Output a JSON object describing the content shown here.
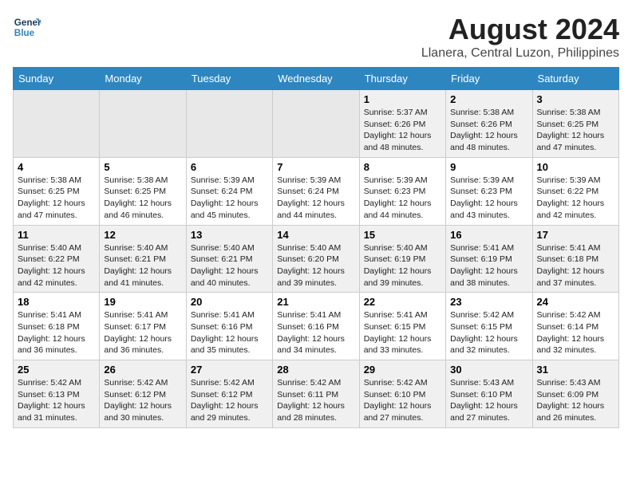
{
  "header": {
    "logo_line1": "General",
    "logo_line2": "Blue",
    "month_year": "August 2024",
    "location": "Llanera, Central Luzon, Philippines"
  },
  "days_of_week": [
    "Sunday",
    "Monday",
    "Tuesday",
    "Wednesday",
    "Thursday",
    "Friday",
    "Saturday"
  ],
  "weeks": [
    [
      {
        "day": "",
        "info": ""
      },
      {
        "day": "",
        "info": ""
      },
      {
        "day": "",
        "info": ""
      },
      {
        "day": "",
        "info": ""
      },
      {
        "day": "1",
        "info": "Sunrise: 5:37 AM\nSunset: 6:26 PM\nDaylight: 12 hours\nand 48 minutes."
      },
      {
        "day": "2",
        "info": "Sunrise: 5:38 AM\nSunset: 6:26 PM\nDaylight: 12 hours\nand 48 minutes."
      },
      {
        "day": "3",
        "info": "Sunrise: 5:38 AM\nSunset: 6:25 PM\nDaylight: 12 hours\nand 47 minutes."
      }
    ],
    [
      {
        "day": "4",
        "info": "Sunrise: 5:38 AM\nSunset: 6:25 PM\nDaylight: 12 hours\nand 47 minutes."
      },
      {
        "day": "5",
        "info": "Sunrise: 5:38 AM\nSunset: 6:25 PM\nDaylight: 12 hours\nand 46 minutes."
      },
      {
        "day": "6",
        "info": "Sunrise: 5:39 AM\nSunset: 6:24 PM\nDaylight: 12 hours\nand 45 minutes."
      },
      {
        "day": "7",
        "info": "Sunrise: 5:39 AM\nSunset: 6:24 PM\nDaylight: 12 hours\nand 44 minutes."
      },
      {
        "day": "8",
        "info": "Sunrise: 5:39 AM\nSunset: 6:23 PM\nDaylight: 12 hours\nand 44 minutes."
      },
      {
        "day": "9",
        "info": "Sunrise: 5:39 AM\nSunset: 6:23 PM\nDaylight: 12 hours\nand 43 minutes."
      },
      {
        "day": "10",
        "info": "Sunrise: 5:39 AM\nSunset: 6:22 PM\nDaylight: 12 hours\nand 42 minutes."
      }
    ],
    [
      {
        "day": "11",
        "info": "Sunrise: 5:40 AM\nSunset: 6:22 PM\nDaylight: 12 hours\nand 42 minutes."
      },
      {
        "day": "12",
        "info": "Sunrise: 5:40 AM\nSunset: 6:21 PM\nDaylight: 12 hours\nand 41 minutes."
      },
      {
        "day": "13",
        "info": "Sunrise: 5:40 AM\nSunset: 6:21 PM\nDaylight: 12 hours\nand 40 minutes."
      },
      {
        "day": "14",
        "info": "Sunrise: 5:40 AM\nSunset: 6:20 PM\nDaylight: 12 hours\nand 39 minutes."
      },
      {
        "day": "15",
        "info": "Sunrise: 5:40 AM\nSunset: 6:19 PM\nDaylight: 12 hours\nand 39 minutes."
      },
      {
        "day": "16",
        "info": "Sunrise: 5:41 AM\nSunset: 6:19 PM\nDaylight: 12 hours\nand 38 minutes."
      },
      {
        "day": "17",
        "info": "Sunrise: 5:41 AM\nSunset: 6:18 PM\nDaylight: 12 hours\nand 37 minutes."
      }
    ],
    [
      {
        "day": "18",
        "info": "Sunrise: 5:41 AM\nSunset: 6:18 PM\nDaylight: 12 hours\nand 36 minutes."
      },
      {
        "day": "19",
        "info": "Sunrise: 5:41 AM\nSunset: 6:17 PM\nDaylight: 12 hours\nand 36 minutes."
      },
      {
        "day": "20",
        "info": "Sunrise: 5:41 AM\nSunset: 6:16 PM\nDaylight: 12 hours\nand 35 minutes."
      },
      {
        "day": "21",
        "info": "Sunrise: 5:41 AM\nSunset: 6:16 PM\nDaylight: 12 hours\nand 34 minutes."
      },
      {
        "day": "22",
        "info": "Sunrise: 5:41 AM\nSunset: 6:15 PM\nDaylight: 12 hours\nand 33 minutes."
      },
      {
        "day": "23",
        "info": "Sunrise: 5:42 AM\nSunset: 6:15 PM\nDaylight: 12 hours\nand 32 minutes."
      },
      {
        "day": "24",
        "info": "Sunrise: 5:42 AM\nSunset: 6:14 PM\nDaylight: 12 hours\nand 32 minutes."
      }
    ],
    [
      {
        "day": "25",
        "info": "Sunrise: 5:42 AM\nSunset: 6:13 PM\nDaylight: 12 hours\nand 31 minutes."
      },
      {
        "day": "26",
        "info": "Sunrise: 5:42 AM\nSunset: 6:12 PM\nDaylight: 12 hours\nand 30 minutes."
      },
      {
        "day": "27",
        "info": "Sunrise: 5:42 AM\nSunset: 6:12 PM\nDaylight: 12 hours\nand 29 minutes."
      },
      {
        "day": "28",
        "info": "Sunrise: 5:42 AM\nSunset: 6:11 PM\nDaylight: 12 hours\nand 28 minutes."
      },
      {
        "day": "29",
        "info": "Sunrise: 5:42 AM\nSunset: 6:10 PM\nDaylight: 12 hours\nand 27 minutes."
      },
      {
        "day": "30",
        "info": "Sunrise: 5:43 AM\nSunset: 6:10 PM\nDaylight: 12 hours\nand 27 minutes."
      },
      {
        "day": "31",
        "info": "Sunrise: 5:43 AM\nSunset: 6:09 PM\nDaylight: 12 hours\nand 26 minutes."
      }
    ]
  ]
}
